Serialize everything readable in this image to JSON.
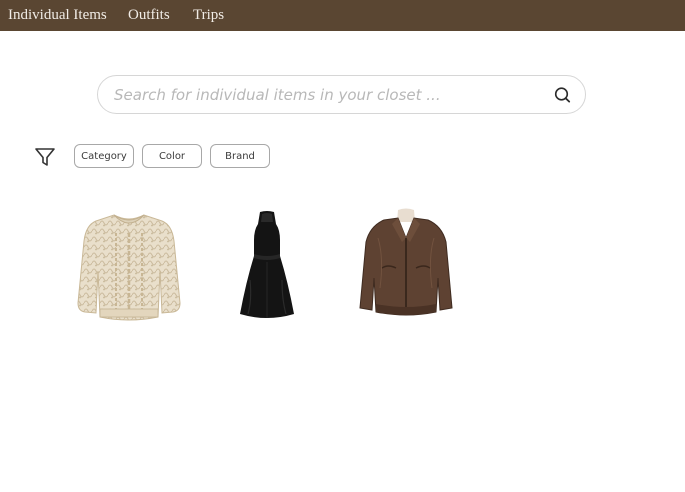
{
  "nav": {
    "items": [
      {
        "label": "Individual Items"
      },
      {
        "label": "Outfits"
      },
      {
        "label": "Trips"
      }
    ]
  },
  "search": {
    "placeholder": "Search for individual items in your closet ...",
    "value": ""
  },
  "filters": {
    "icon": "filter-icon",
    "chips": [
      {
        "label": "Category"
      },
      {
        "label": "Color"
      },
      {
        "label": "Brand"
      }
    ]
  },
  "items": [
    {
      "icon": "cable-knit-sweater-image",
      "color": "#e8dcc6"
    },
    {
      "icon": "black-halter-dress-image",
      "color": "#111111"
    },
    {
      "icon": "brown-leather-jacket-image",
      "color": "#5b4030"
    }
  ],
  "colors": {
    "nav_bg": "#5a4632",
    "nav_text": "#f1ece6"
  }
}
